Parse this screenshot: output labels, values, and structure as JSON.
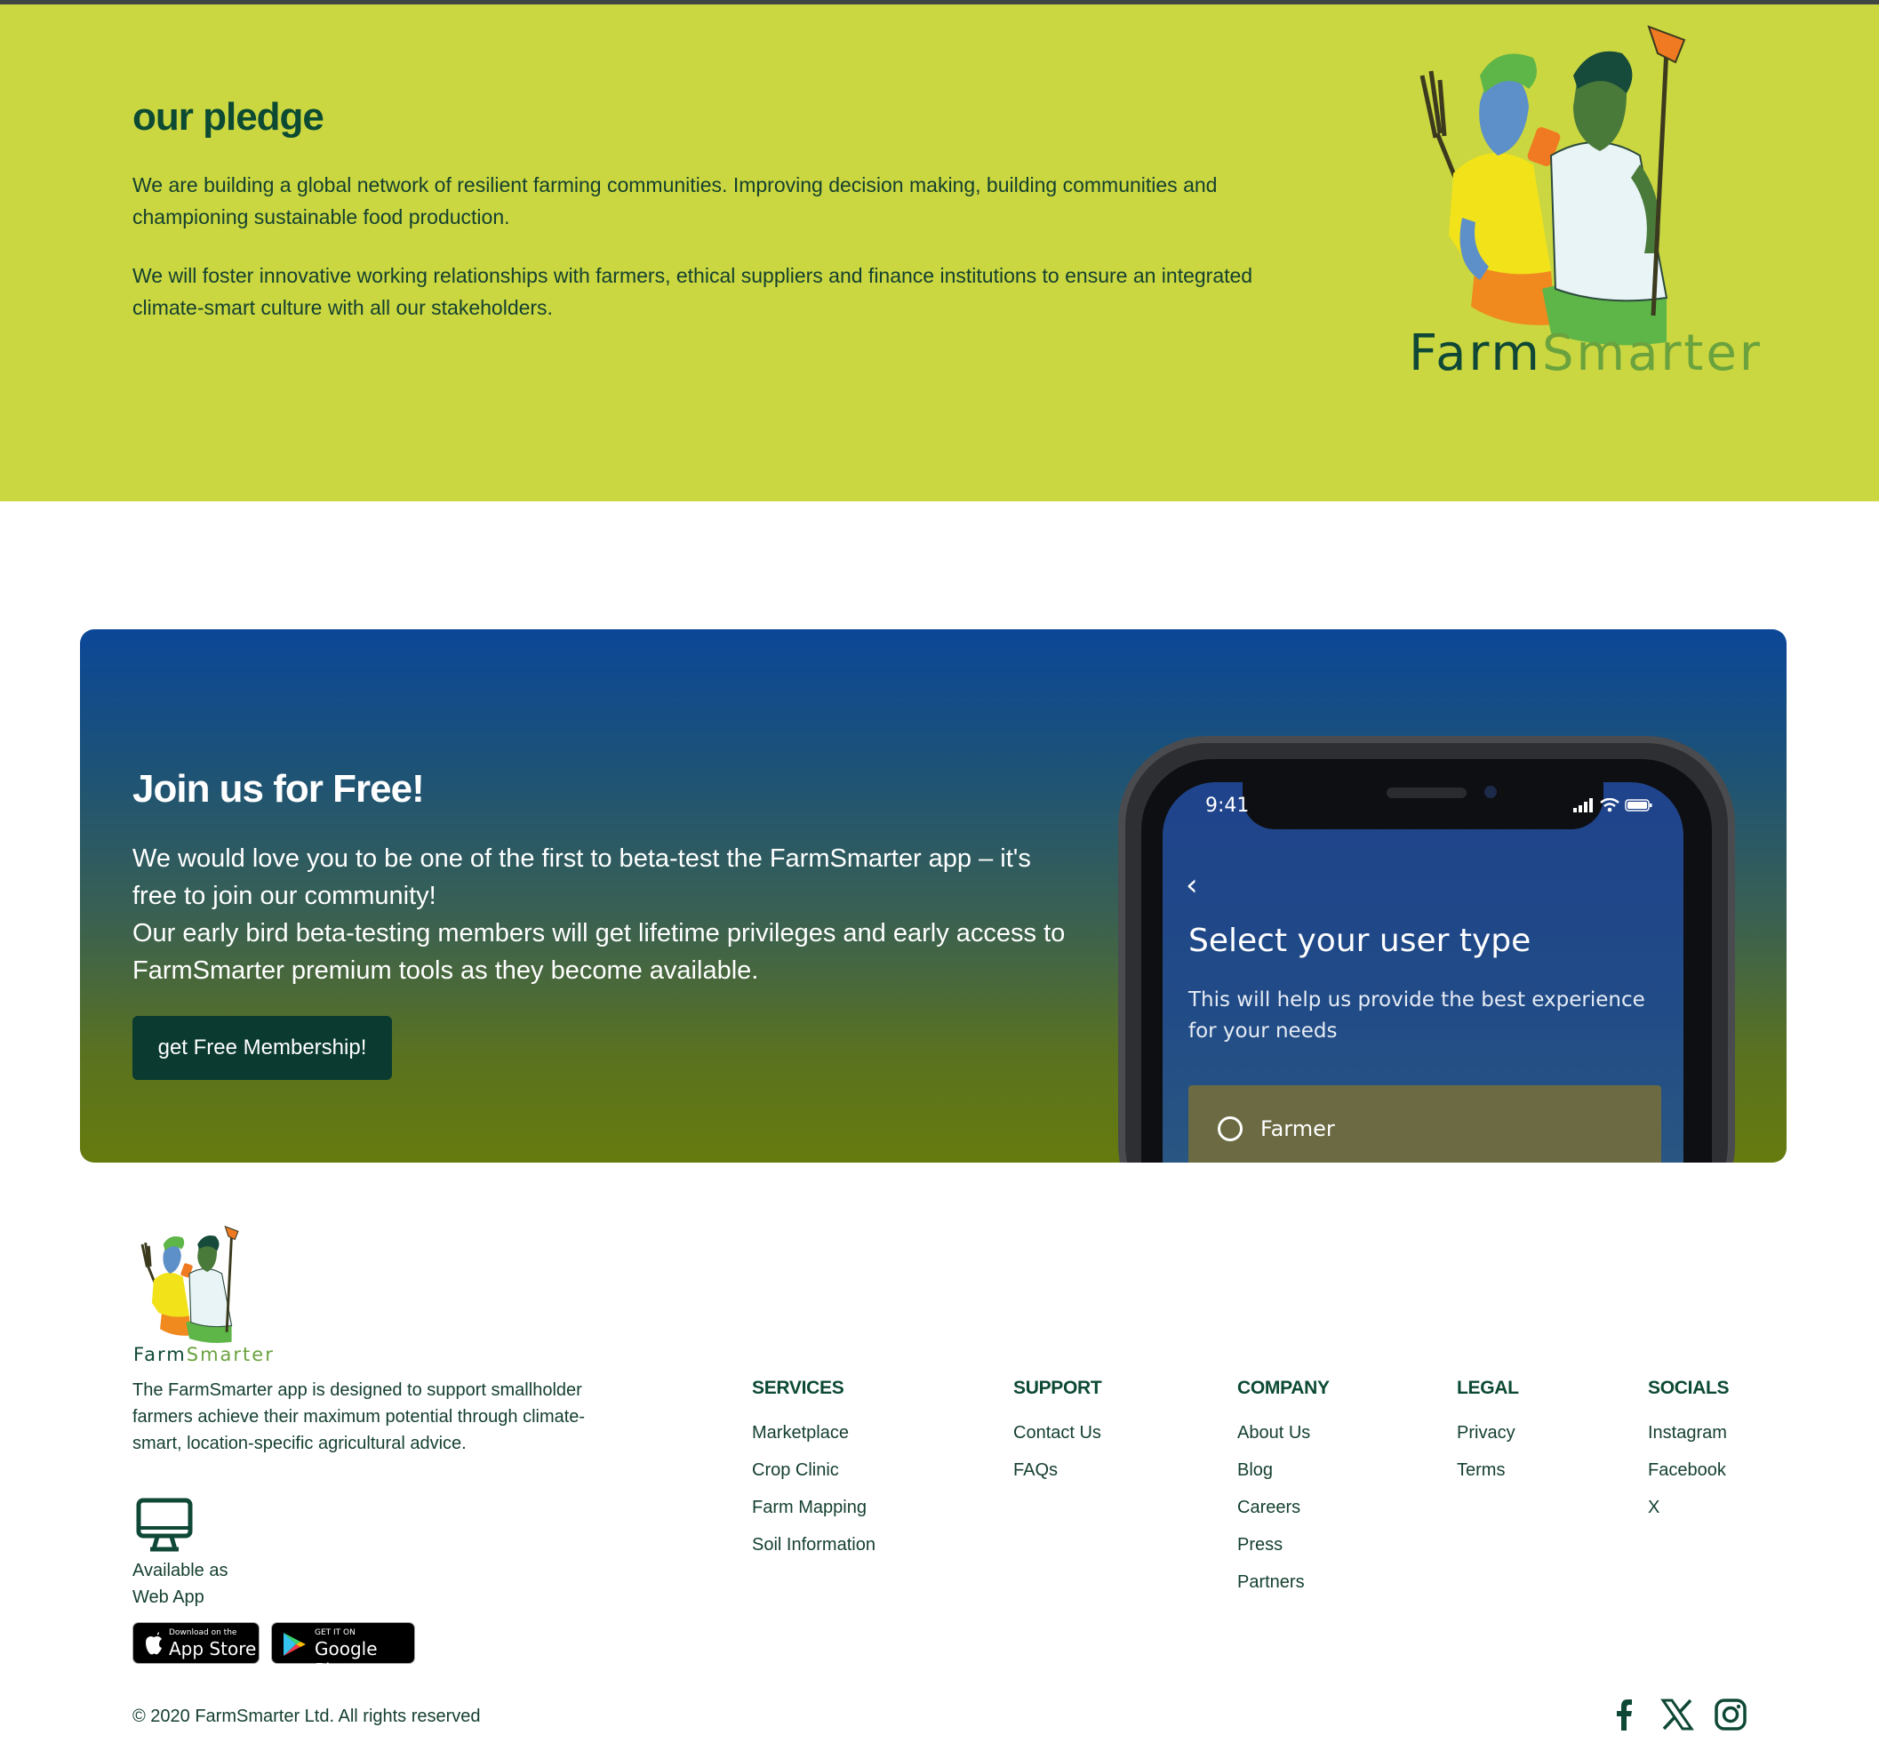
{
  "pledge": {
    "title": "our pledge",
    "paragraph1": "We are building a global network of resilient farming communities. Improving decision making, building communities and championing sustainable food production.",
    "paragraph2": "We will foster innovative working relationships with farmers, ethical suppliers and finance institutions to ensure an integrated climate-smart culture with all our stakeholders.",
    "brand_farm": "Farm",
    "brand_smarter": "Smarter"
  },
  "join": {
    "title": "Join us for Free!",
    "body_line1": "We would love you to be one of the first to beta-test the FarmSmarter app – it's free to join our community!",
    "body_line2": "Our early bird beta-testing members will get lifetime privileges and early access to FarmSmarter premium tools as they become available.",
    "cta_label": "get Free Membership!"
  },
  "phone": {
    "time": "9:41",
    "screen_title": "Select your user type",
    "screen_subtitle": "This will help us provide the best experience for your needs",
    "option_label": "Farmer"
  },
  "footer": {
    "brand_farm": "Farm",
    "brand_smarter": "Smarter",
    "description": "The FarmSmarter app is designed to support smallholder farmers achieve their maximum potential through climate-smart, location-specific agricultural advice.",
    "webapp_line1": "Available as",
    "webapp_line2": "Web App",
    "appstore_small": "Download on the",
    "appstore_big": "App Store",
    "googleplay_small": "GET IT ON",
    "googleplay_big": "Google Play",
    "columns": {
      "services": {
        "heading": "SERVICES",
        "links": [
          "Marketplace",
          "Crop Clinic",
          "Farm Mapping",
          "Soil Information"
        ]
      },
      "support": {
        "heading": "SUPPORT",
        "links": [
          "Contact Us",
          "FAQs"
        ]
      },
      "company": {
        "heading": "COMPANY",
        "links": [
          "About Us",
          "Blog",
          "Careers",
          "Press",
          "Partners"
        ]
      },
      "legal": {
        "heading": "LEGAL",
        "links": [
          "Privacy",
          "Terms"
        ]
      },
      "socials": {
        "heading": "SOCIALS",
        "links": [
          "Instagram",
          "Facebook",
          "X"
        ]
      }
    },
    "copyright": "© 2020 FarmSmarter Ltd. All rights reserved",
    "social_icons": [
      "facebook-icon",
      "x-icon",
      "instagram-icon"
    ]
  },
  "colors": {
    "pledge_bg": "#cad740",
    "dark_green": "#0a3a30",
    "brand_green": "#6aa23e",
    "join_gradient_top": "#0b4798",
    "join_gradient_bottom": "#667b0e"
  }
}
